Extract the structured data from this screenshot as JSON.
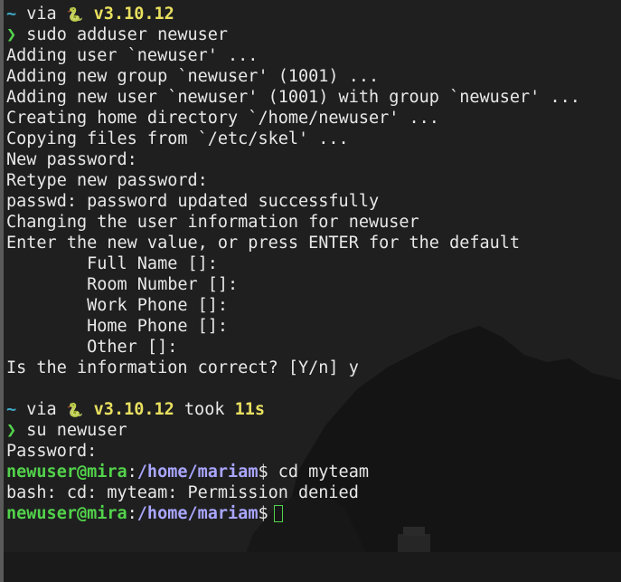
{
  "colors": {
    "background": "#1d1d1e",
    "text": "#e8e8e8",
    "cyan_tilde": "#3fa7c4",
    "yellow_version": "#e9e05f",
    "green_prompt": "#53d34b",
    "purple_path": "#a9a6ff"
  },
  "prompt1": {
    "tilde": "~",
    "via": " via ",
    "snake": "🐍",
    "version": " v3.10.12",
    "arrow": "❯",
    "command": " sudo adduser newuser"
  },
  "output1": [
    "Adding user `newuser' ...",
    "Adding new group `newuser' (1001) ...",
    "Adding new user `newuser' (1001) with group `newuser' ...",
    "Creating home directory `/home/newuser' ...",
    "Copying files from `/etc/skel' ...",
    "New password:",
    "Retype new password:",
    "passwd: password updated successfully",
    "Changing the user information for newuser",
    "Enter the new value, or press ENTER for the default",
    "        Full Name []:",
    "        Room Number []:",
    "        Work Phone []:",
    "        Home Phone []:",
    "        Other []:",
    "Is the information correct? [Y/n] y"
  ],
  "prompt2": {
    "tilde": "~",
    "via": " via ",
    "snake": "🐍",
    "version": " v3.10.12",
    "took": " took ",
    "duration": "11s",
    "arrow": "❯",
    "command": " su newuser"
  },
  "output2": [
    "Password:"
  ],
  "shell1": {
    "userhost": "newuser@mira",
    "colon": ":",
    "path": "/home/mariam",
    "dollar": "$",
    "command": " cd myteam"
  },
  "output3": [
    "bash: cd: myteam: Permission denied"
  ],
  "shell2": {
    "userhost": "newuser@mira",
    "colon": ":",
    "path": "/home/mariam",
    "dollar": "$"
  }
}
